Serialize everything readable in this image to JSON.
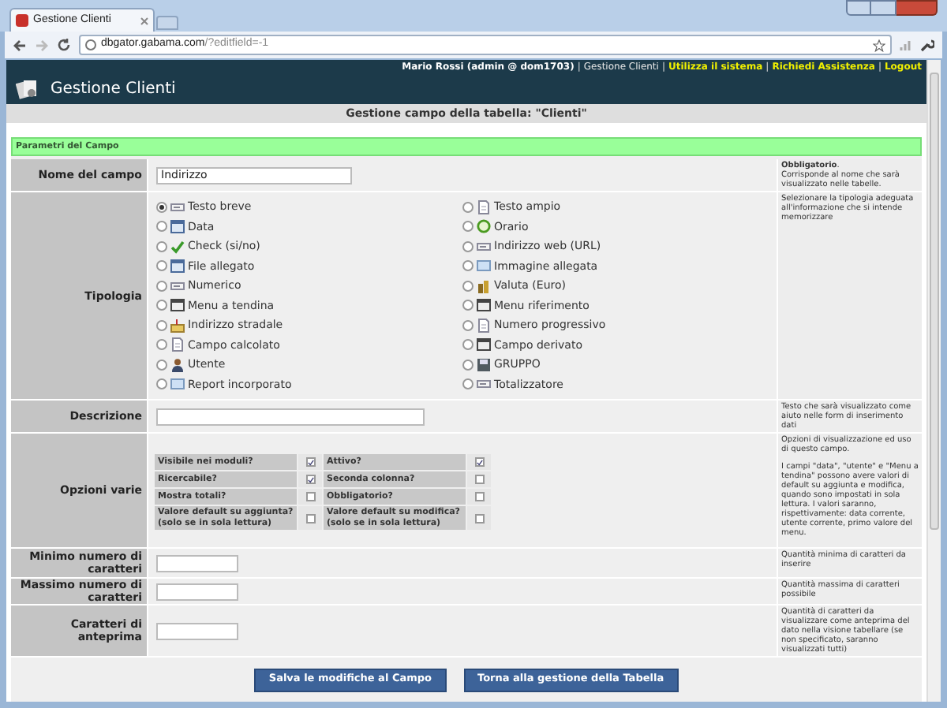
{
  "browser": {
    "tab_title": "Gestione Clienti",
    "url_host": "dbgator.gabama.com",
    "url_path": "/?editfield=-1"
  },
  "topbar": {
    "user": "Mario Rossi (admin @ dom1703)",
    "links": [
      {
        "label": "Gestione Clienti",
        "highlighted": false,
        "separator": "|"
      },
      {
        "label": "Utilizza il sistema",
        "highlighted": true,
        "separator": "|"
      },
      {
        "label": "Richiedi Assistenza",
        "highlighted": true,
        "separator": "|"
      },
      {
        "label": "Logout",
        "highlighted": true,
        "separator": "|"
      }
    ]
  },
  "app_title": "Gestione Clienti",
  "page_title": "Gestione campo della tabella: \"Clienti\"",
  "section": "Parametri del Campo",
  "rows": [
    {
      "kind": "input",
      "label": "Nome del campo",
      "value": "Indirizzo",
      "wide": false,
      "help": [
        "**Obbligatorio**.",
        "Corrisponde al nome che sarà visualizzato nelle tabelle."
      ]
    },
    {
      "kind": "radio",
      "label": "Tipologia",
      "columns": [
        [
          {
            "label": "Testo breve",
            "selected": true
          },
          {
            "label": "Data",
            "selected": false
          },
          {
            "label": "Check (si/no)",
            "selected": false
          },
          {
            "label": "File allegato",
            "selected": false
          },
          {
            "label": "Numerico",
            "selected": false
          },
          {
            "label": "Menu a tendina",
            "selected": false
          },
          {
            "label": "Indirizzo stradale",
            "selected": false
          },
          {
            "label": "Campo calcolato",
            "selected": false
          },
          {
            "label": "Utente",
            "selected": false
          },
          {
            "label": "Report incorporato",
            "selected": false
          }
        ],
        [
          {
            "label": "Testo ampio",
            "selected": false
          },
          {
            "label": "Orario",
            "selected": false
          },
          {
            "label": "Indirizzo web (URL)",
            "selected": false
          },
          {
            "label": "Immagine allegata",
            "selected": false
          },
          {
            "label": "Valuta (Euro)",
            "selected": false
          },
          {
            "label": "Menu riferimento",
            "selected": false
          },
          {
            "label": "Numero progressivo",
            "selected": false
          },
          {
            "label": "Campo derivato",
            "selected": false
          },
          {
            "label": "GRUPPO",
            "selected": false
          },
          {
            "label": "Totalizzatore",
            "selected": false
          }
        ]
      ],
      "help": [
        "Selezionare la tipologia adeguata all'informazione che si intende memorizzare"
      ]
    },
    {
      "kind": "input",
      "label": "Descrizione",
      "value": "",
      "wide": true,
      "help": [
        "Testo che sarà visualizzato come aiuto nelle form di inserimento dati"
      ]
    },
    {
      "kind": "checkboxes",
      "label": "Opzioni varie",
      "options": [
        {
          "label": "Visibile nei moduli?",
          "checked": true
        },
        {
          "label": "Attivo?",
          "checked": true
        },
        {
          "label": "Ricercabile?",
          "checked": true
        },
        {
          "label": "Seconda colonna?",
          "checked": false
        },
        {
          "label": "Mostra totali?",
          "checked": false
        },
        {
          "label": "Obbligatorio?",
          "checked": false
        },
        {
          "label": "Valore default su aggiunta?",
          "note": "(solo se in sola lettura)",
          "checked": false
        },
        {
          "label": "Valore default su modifica?",
          "note": "(solo se in sola lettura)",
          "checked": false
        }
      ],
      "help": [
        "Opzioni di visualizzazione ed uso di questo campo.",
        "I campi \"data\", \"utente\" e \"Menu a tendina\" possono avere valori di default su aggiunta e modifica, quando sono impostati in sola lettura. I valori saranno, rispettivamente: data corrente, utente corrente, primo valore del menu."
      ]
    },
    {
      "kind": "input",
      "label": "Minimo numero di caratteri",
      "value": "",
      "wide": false,
      "help": [
        "Quantità minima di caratteri da inserire"
      ]
    },
    {
      "kind": "input",
      "label": "Massimo numero di caratteri",
      "value": "",
      "wide": false,
      "help": [
        "Quantità massima di caratteri possibile"
      ]
    },
    {
      "kind": "input",
      "label": "Caratteri di anteprima",
      "value": "",
      "wide": false,
      "help": [
        "Quantità di caratteri da visualizzare come anteprima del dato nella visione tabellare (se non specificato, saranno visualizzati tutti)"
      ]
    }
  ],
  "buttons": [
    "Salva le modifiche al Campo",
    "Torna alla gestione della Tabella"
  ]
}
